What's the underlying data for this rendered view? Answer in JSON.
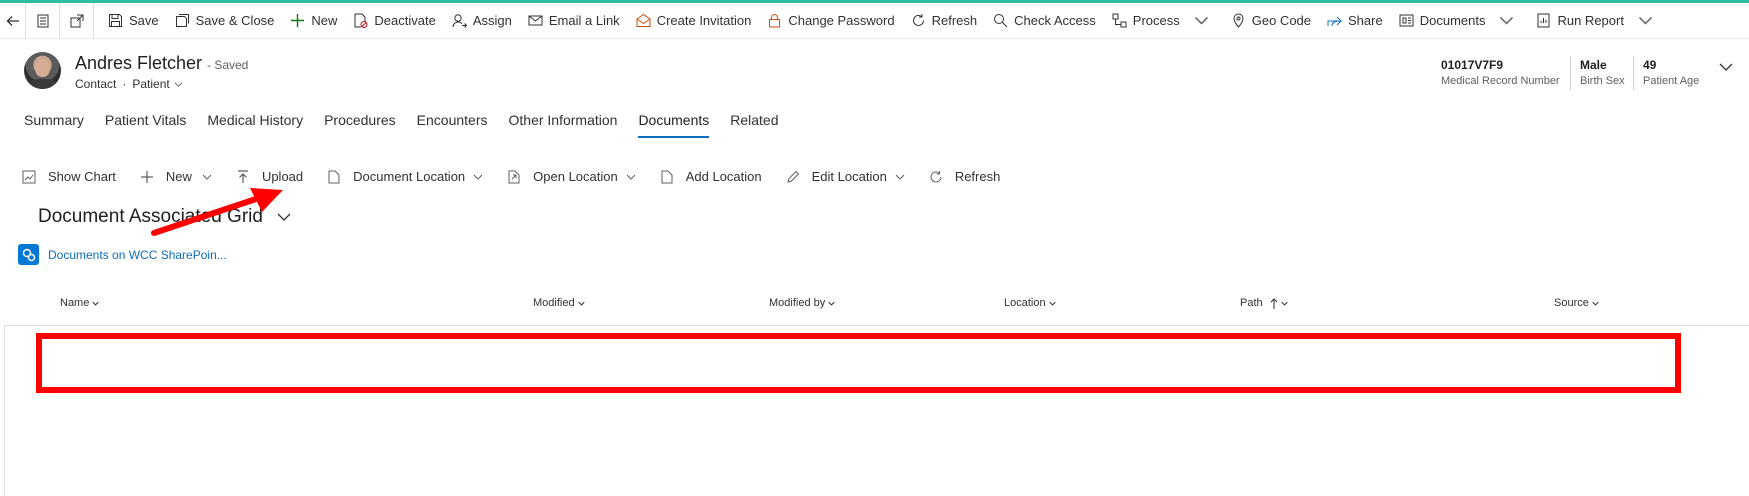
{
  "command_bar": {
    "items": [
      {
        "label": "Save",
        "icon": "save-icon"
      },
      {
        "label": "Save & Close",
        "icon": "save-close-icon"
      },
      {
        "label": "New",
        "icon": "plus-icon"
      },
      {
        "label": "Deactivate",
        "icon": "deactivate-icon"
      },
      {
        "label": "Assign",
        "icon": "assign-icon"
      },
      {
        "label": "Email a Link",
        "icon": "email-icon"
      },
      {
        "label": "Create Invitation",
        "icon": "invitation-icon"
      },
      {
        "label": "Change Password",
        "icon": "lock-icon"
      },
      {
        "label": "Refresh",
        "icon": "refresh-icon"
      },
      {
        "label": "Check Access",
        "icon": "check-access-icon"
      },
      {
        "label": "Process",
        "icon": "process-icon"
      },
      {
        "label": "Geo Code",
        "icon": "map-pin-icon"
      },
      {
        "label": "Share",
        "icon": "share-icon"
      },
      {
        "label": "Documents",
        "icon": "documents-icon"
      },
      {
        "label": "Run Report",
        "icon": "report-icon"
      }
    ]
  },
  "record": {
    "name": "Andres Fletcher",
    "saved_status": "- Saved",
    "entity": "Contact",
    "separator": "·",
    "form": "Patient",
    "fields": [
      {
        "value": "01017V7F9",
        "label": "Medical Record Number"
      },
      {
        "value": "Male",
        "label": "Birth Sex"
      },
      {
        "value": "49",
        "label": "Patient Age"
      }
    ]
  },
  "tabs": [
    {
      "label": "Summary",
      "active": false
    },
    {
      "label": "Patient Vitals",
      "active": false
    },
    {
      "label": "Medical History",
      "active": false
    },
    {
      "label": "Procedures",
      "active": false
    },
    {
      "label": "Encounters",
      "active": false
    },
    {
      "label": "Other Information",
      "active": false
    },
    {
      "label": "Documents",
      "active": true
    },
    {
      "label": "Related",
      "active": false
    }
  ],
  "subgrid_bar": {
    "items": [
      {
        "label": "Show Chart",
        "icon": "chart-icon"
      },
      {
        "label": "New",
        "icon": "plus-icon"
      },
      {
        "label": "Upload",
        "icon": "upload-icon"
      },
      {
        "label": "Document Location",
        "icon": "document-icon"
      },
      {
        "label": "Open Location",
        "icon": "open-location-icon"
      },
      {
        "label": "Add Location",
        "icon": "add-location-icon"
      },
      {
        "label": "Edit Location",
        "icon": "edit-icon"
      },
      {
        "label": "Refresh",
        "icon": "refresh-icon"
      }
    ]
  },
  "grid": {
    "title": "Document Associated Grid",
    "sharepoint_link": "Documents on WCC SharePoin...",
    "columns": [
      "Name",
      "Modified",
      "Modified by",
      "Location",
      "Path",
      "Source"
    ]
  },
  "annotation_color": "#ff0000",
  "accent_color": "#0f6cbd"
}
